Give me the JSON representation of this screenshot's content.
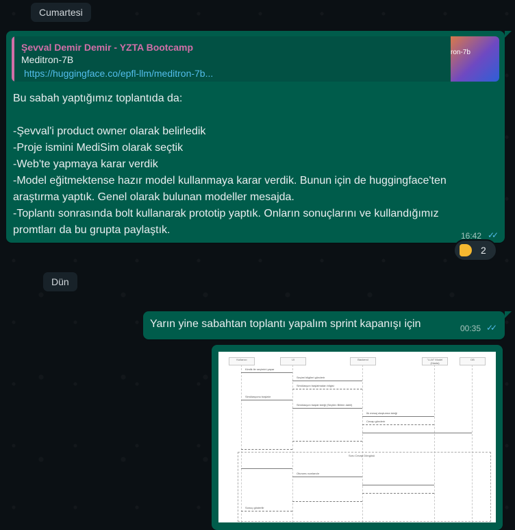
{
  "dates": {
    "first": "Cumartesi",
    "second": "Dün"
  },
  "message1": {
    "quote_author": "Şevval Demir Demir - YZTA Bootcamp",
    "quote_title": "Meditron-7B",
    "quote_link": "https://huggingface.co/epfl-llm/meditron-7b...",
    "thumb_text": "ron-7b",
    "lines": [
      "Bu sabah yaptığımız toplantıda da:",
      "",
      "-Şevval'i product owner olarak belirledik",
      "-Proje ismini MediSim olarak seçtik",
      "-Web'te yapmaya karar verdik",
      "-Model eğitmektense hazır model kullanmaya karar verdik. Bunun için de huggingface'ten",
      "araştırma yaptık. Genel olarak bulunan modeller mesajda.",
      "-Toplantı sonrasında bolt kullanarak prototip yaptık. Onların sonuçlarını ve kullandığımız",
      "promtları da bu grupta paylaştık."
    ],
    "time": "16:42",
    "reaction_count": "2",
    "reaction_icon": "thumbs-up-icon"
  },
  "message2": {
    "text": "Yarın yine sabahtan toplantı yapalım sprint kapanışı için",
    "time": "00:35"
  },
  "diagram": {
    "participants": [
      "Kullanıcı",
      "UI",
      "Backend",
      "\"LLM\" Model (Hasta)",
      "DB"
    ],
    "labels": [
      "Kimlik ile seçimini yapar",
      "Seçimi bilgileri gönderir",
      "Simülasyon başlatmaları bilgisi",
      "Simülasyonu başlatır",
      "Simülasyon başlat isteği (Seçilen Bilirim dahil)",
      "İlk mesaj oluşturma isteği",
      "Cevap gönderir",
      "Soru Cevap Döngüsü",
      "Oturumu sonlandır",
      "Sonuç gösterilir"
    ]
  },
  "colors": {
    "outgoing_bubble": "#005c4b",
    "background": "#0b1014",
    "author_pink": "#d16fa8",
    "link_blue": "#53bdeb",
    "read_ticks": "#53bdeb"
  }
}
